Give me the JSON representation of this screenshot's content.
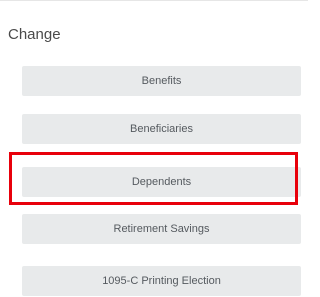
{
  "section": {
    "title": "Change"
  },
  "buttons": [
    {
      "label": "Benefits"
    },
    {
      "label": "Beneficiaries"
    },
    {
      "label": "Dependents"
    },
    {
      "label": "Retirement Savings"
    },
    {
      "label": "1095-C Printing Election"
    }
  ],
  "highlight": {
    "color": "#e8000b",
    "target": "Dependents"
  }
}
